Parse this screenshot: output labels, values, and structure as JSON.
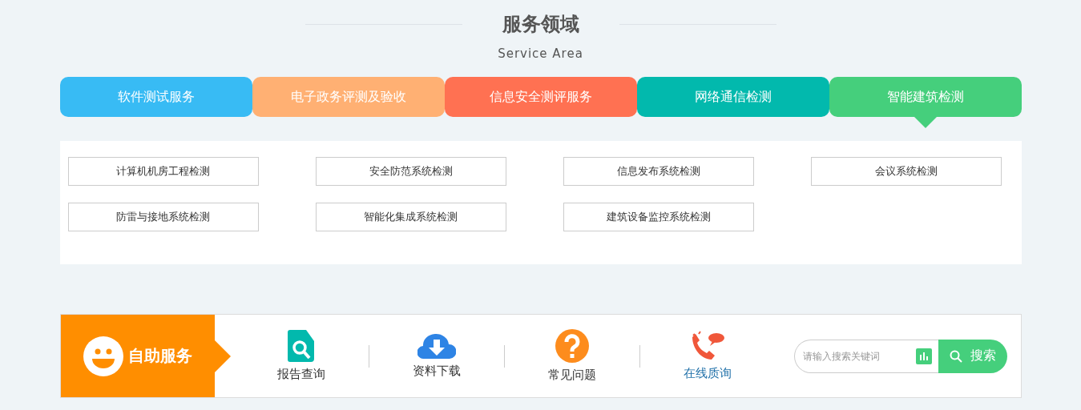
{
  "section": {
    "title": "服务领域",
    "subtitle": "Service Area"
  },
  "tabs": [
    {
      "label": "软件测试服务",
      "color": "#38bbf4",
      "selected": false
    },
    {
      "label": "电子政务评测及验收",
      "color": "#ffb073",
      "selected": false
    },
    {
      "label": "信息安全测评服务",
      "color": "#ff7152",
      "selected": false
    },
    {
      "label": "网络通信检测",
      "color": "#02b9ad",
      "selected": false
    },
    {
      "label": "智能建筑检测",
      "color": "#45cf7c",
      "selected": true
    }
  ],
  "services": [
    "计算机机房工程检测",
    "安全防范系统检测",
    "信息发布系统检测",
    "会议系统检测",
    "防雷与接地系统检测",
    "智能化集成系统检测",
    "建筑设备监控系统检测"
  ],
  "self_service": {
    "title": "自助服务",
    "links": [
      {
        "kind": "report",
        "label": "报告查询",
        "active": false
      },
      {
        "kind": "download",
        "label": "资料下载",
        "active": false
      },
      {
        "kind": "faq",
        "label": "常见问题",
        "active": false
      },
      {
        "kind": "consult",
        "label": "在线质询",
        "active": true
      }
    ],
    "search": {
      "placeholder": "请输入搜索关键词",
      "button": "搜索"
    }
  }
}
